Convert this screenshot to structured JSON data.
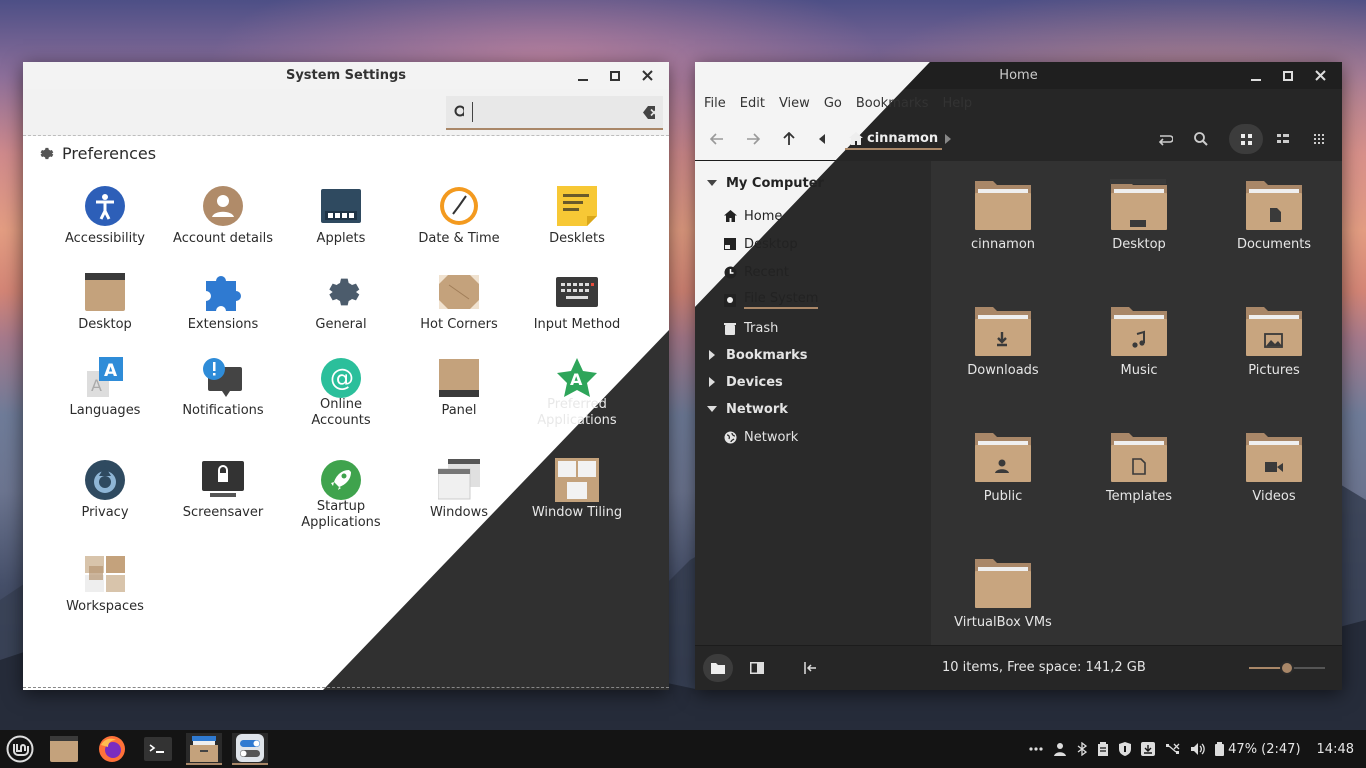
{
  "settings": {
    "title": "System Settings",
    "search_value": "",
    "section": "Preferences",
    "items": [
      {
        "label": "Accessibility"
      },
      {
        "label": "Account details"
      },
      {
        "label": "Applets"
      },
      {
        "label": "Date & Time"
      },
      {
        "label": "Desklets"
      },
      {
        "label": "Desktop"
      },
      {
        "label": "Extensions"
      },
      {
        "label": "General"
      },
      {
        "label": "Hot Corners"
      },
      {
        "label": "Input Method"
      },
      {
        "label": "Languages"
      },
      {
        "label": "Notifications"
      },
      {
        "label": "Online\nAccounts"
      },
      {
        "label": "Panel"
      },
      {
        "label": "Preferred\nApplications"
      },
      {
        "label": "Privacy"
      },
      {
        "label": "Screensaver"
      },
      {
        "label": "Startup\nApplications"
      },
      {
        "label": "Windows"
      },
      {
        "label": "Window Tiling"
      },
      {
        "label": "Workspaces"
      }
    ]
  },
  "nemo": {
    "title": "Home",
    "menu": [
      "File",
      "Edit",
      "View",
      "Go",
      "Bookmarks",
      "Help"
    ],
    "location": "cinnamon",
    "sidebar": {
      "my_computer": "My Computer",
      "places": [
        "Home",
        "Desktop",
        "Recent",
        "File System",
        "Trash"
      ],
      "bookmarks": "Bookmarks",
      "devices": "Devices",
      "network": "Network",
      "network_items": [
        "Network"
      ]
    },
    "files": [
      "cinnamon",
      "Desktop",
      "Documents",
      "Downloads",
      "Music",
      "Pictures",
      "Public",
      "Templates",
      "Videos",
      "VirtualBox VMs"
    ],
    "status": "10 items, Free space: 141,2 GB",
    "zoom": 0.5
  },
  "panel": {
    "battery": "47% (2:47)",
    "clock": "14:48"
  },
  "colors": {
    "accent": "#a98768",
    "folder": "#c8a57f",
    "folder_dark": "#a98768"
  }
}
